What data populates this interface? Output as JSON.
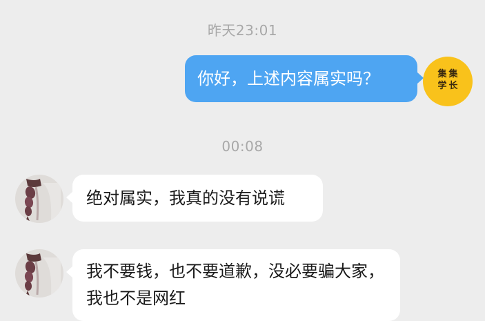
{
  "conversation": {
    "timestamps": [
      "昨天23:01",
      "00:08"
    ],
    "outgoing": {
      "text": "你好，上述内容属实吗？",
      "avatar": {
        "logo_left": "集学",
        "logo_right": "集长",
        "color": "#f9c21b"
      }
    },
    "incoming": [
      {
        "text": "绝对属实，我真的没有说谎",
        "avatar_icon": "braided-hair-avatar"
      },
      {
        "text": "我不要钱，也不要道歉，没必要骗大家，我也不是网红",
        "avatar_icon": "braided-hair-avatar"
      }
    ]
  },
  "colors": {
    "background": "#ededed",
    "outgoing_bubble": "#4ea5f2",
    "incoming_bubble": "#ffffff",
    "timestamp_text": "#a8a8a8"
  }
}
